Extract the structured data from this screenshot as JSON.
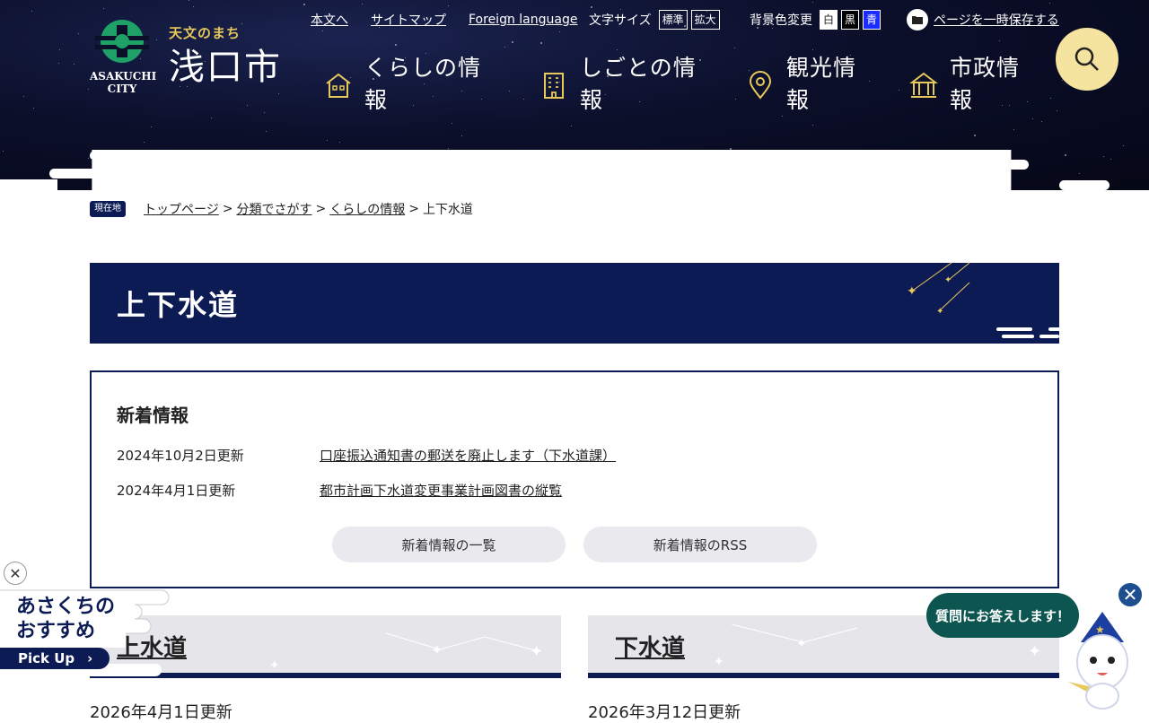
{
  "header": {
    "logo": {
      "tagline": "天文のまち",
      "city_name": "浅口市",
      "city_en": "ASAKUCHI CITY"
    },
    "util": {
      "skip": "本文へ",
      "sitemap": "サイトマップ",
      "foreign": "Foreign language",
      "font_size_label": "文字サイズ",
      "font_standard": "標準",
      "font_large": "拡大",
      "bg_label": "背景色変更",
      "bg_white": "白",
      "bg_black": "黒",
      "bg_blue": "青",
      "save": "ページを一時保存する"
    },
    "nav": [
      {
        "label": "くらしの情報",
        "icon": "house-icon"
      },
      {
        "label": "しごとの情報",
        "icon": "building-icon"
      },
      {
        "label": "観光情報",
        "icon": "map-pin-icon"
      },
      {
        "label": "市政情報",
        "icon": "city-hall-icon"
      }
    ],
    "search_icon": "search-icon"
  },
  "breadcrumb": {
    "here": "現在地",
    "items": [
      "トップページ",
      "分類でさがす",
      "くらしの情報"
    ],
    "current": "上下水道"
  },
  "page_title": "上下水道",
  "news": {
    "heading": "新着情報",
    "items": [
      {
        "date": "2024年10月2日更新",
        "title": "口座振込通知書の郵送を廃止します（下水道課）"
      },
      {
        "date": "2024年4月1日更新",
        "title": "都市計画下水道変更事業計画図書の縦覧"
      }
    ],
    "list_button": "新着情報の一覧",
    "rss_button": "新着情報のRSS"
  },
  "categories": [
    {
      "title": "上水道",
      "date": "2026年4月1日更新"
    },
    {
      "title": "下水道",
      "date": "2026年3月12日更新"
    }
  ],
  "pickup": {
    "line1": "あさくちの",
    "line2": "おすすめ",
    "button": "Pick Up"
  },
  "chat": {
    "bubble": "質問にお答えします！"
  },
  "colors": {
    "navy": "#0d1b55",
    "gold": "#e7c85a",
    "search_bg": "#f5e3a0",
    "chat_green": "#0d5550"
  }
}
